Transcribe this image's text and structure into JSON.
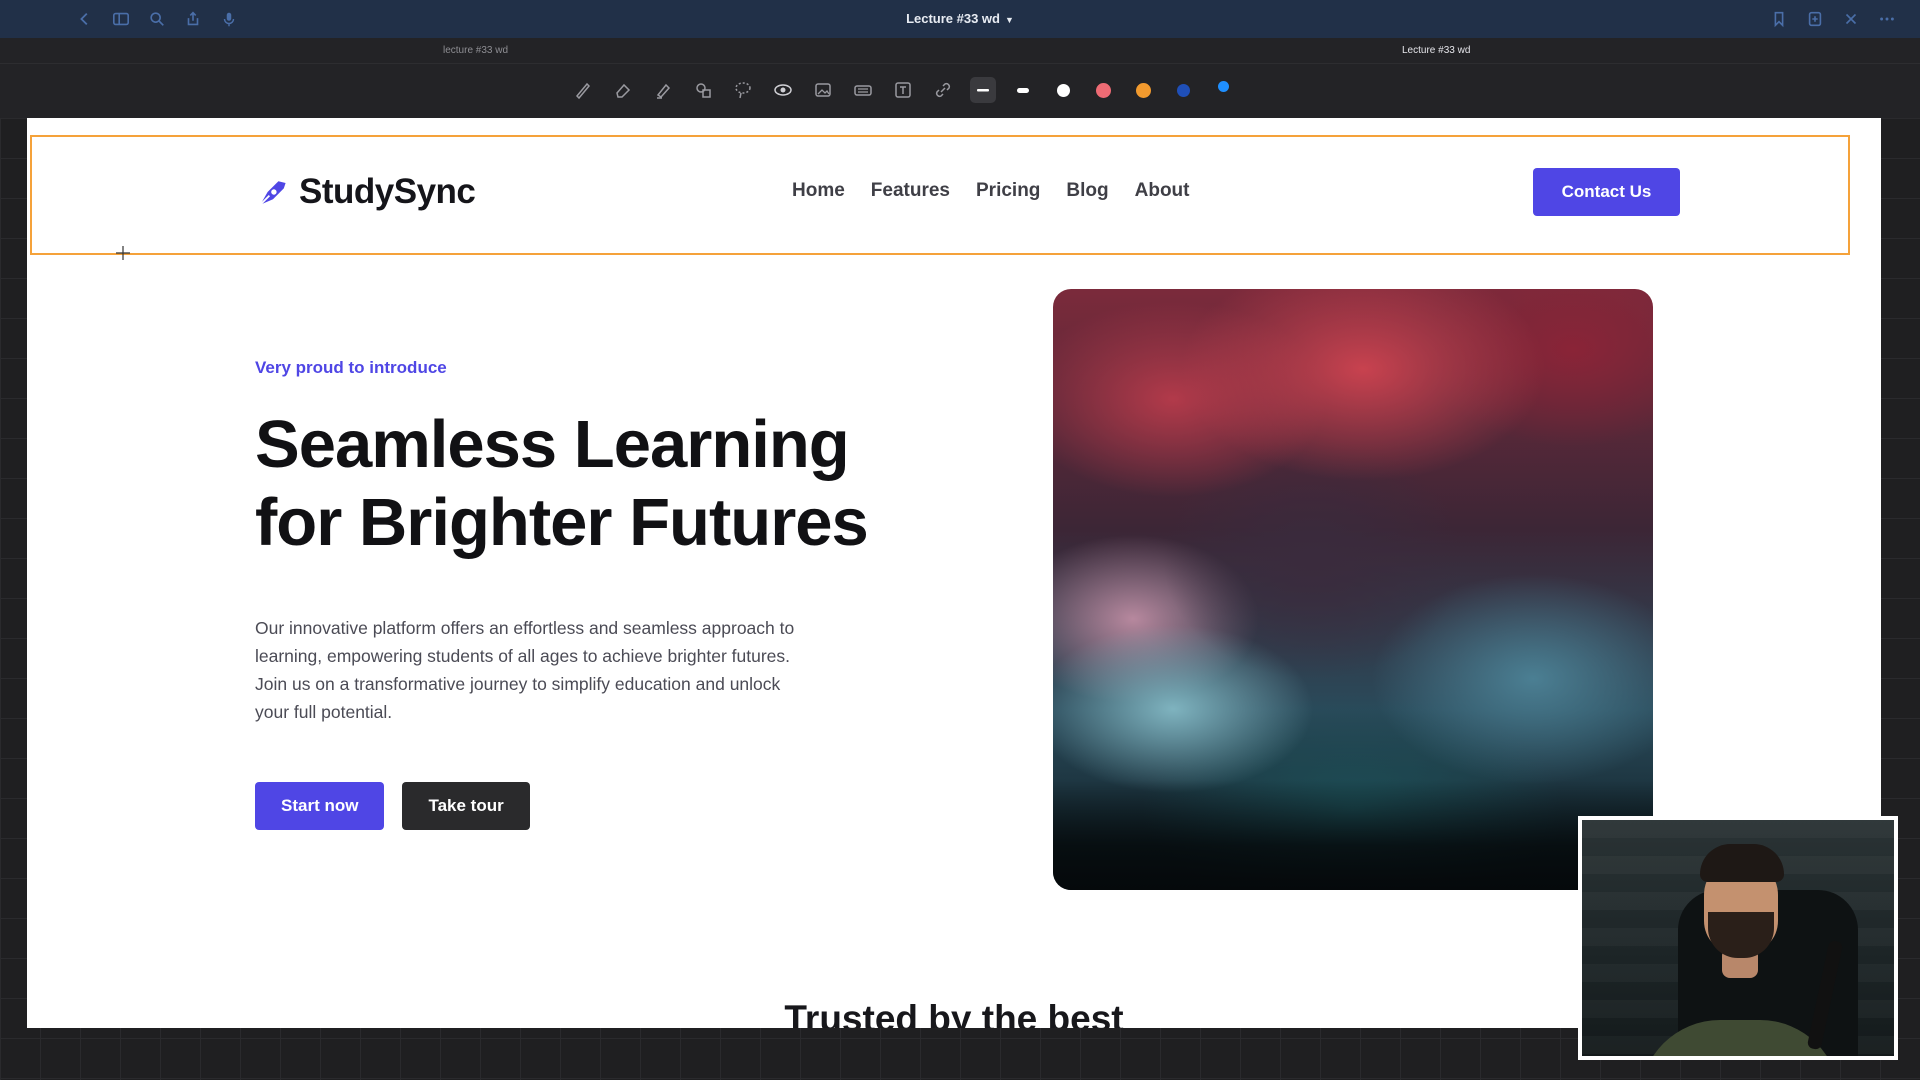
{
  "window": {
    "title": "Lecture #33 wd",
    "tabs": [
      {
        "label": "lecture #33 wd"
      },
      {
        "label": "Lecture #33 wd"
      }
    ]
  },
  "toolbar": {
    "tools": [
      "pen-tool",
      "eraser-tool",
      "highlighter-tool",
      "shapes-tool",
      "lasso-tool",
      "eye-tool",
      "image-tool",
      "keyboard-tool",
      "text-tool",
      "link-tool"
    ],
    "colors": [
      "#ffffff",
      "#ffffff",
      "#ee6b74",
      "#f29a2e",
      "#1f4fb8",
      "#1f8fff"
    ]
  },
  "site": {
    "brand": "StudySync",
    "nav": [
      "Home",
      "Features",
      "Pricing",
      "Blog",
      "About"
    ],
    "contact_label": "Contact Us",
    "hero": {
      "eyebrow": "Very proud to introduce",
      "headline_line1": "Seamless Learning",
      "headline_line2": "for Brighter Futures",
      "body": "Our innovative platform offers an effortless and seamless approach to learning, empowering students of all ages to achieve brighter futures. Join us on a transformative journey to simplify education and unlock your full potential.",
      "primary_cta": "Start now",
      "secondary_cta": "Take tour"
    },
    "section_title": "Trusted by the best",
    "accent_color": "#4f46e5"
  }
}
